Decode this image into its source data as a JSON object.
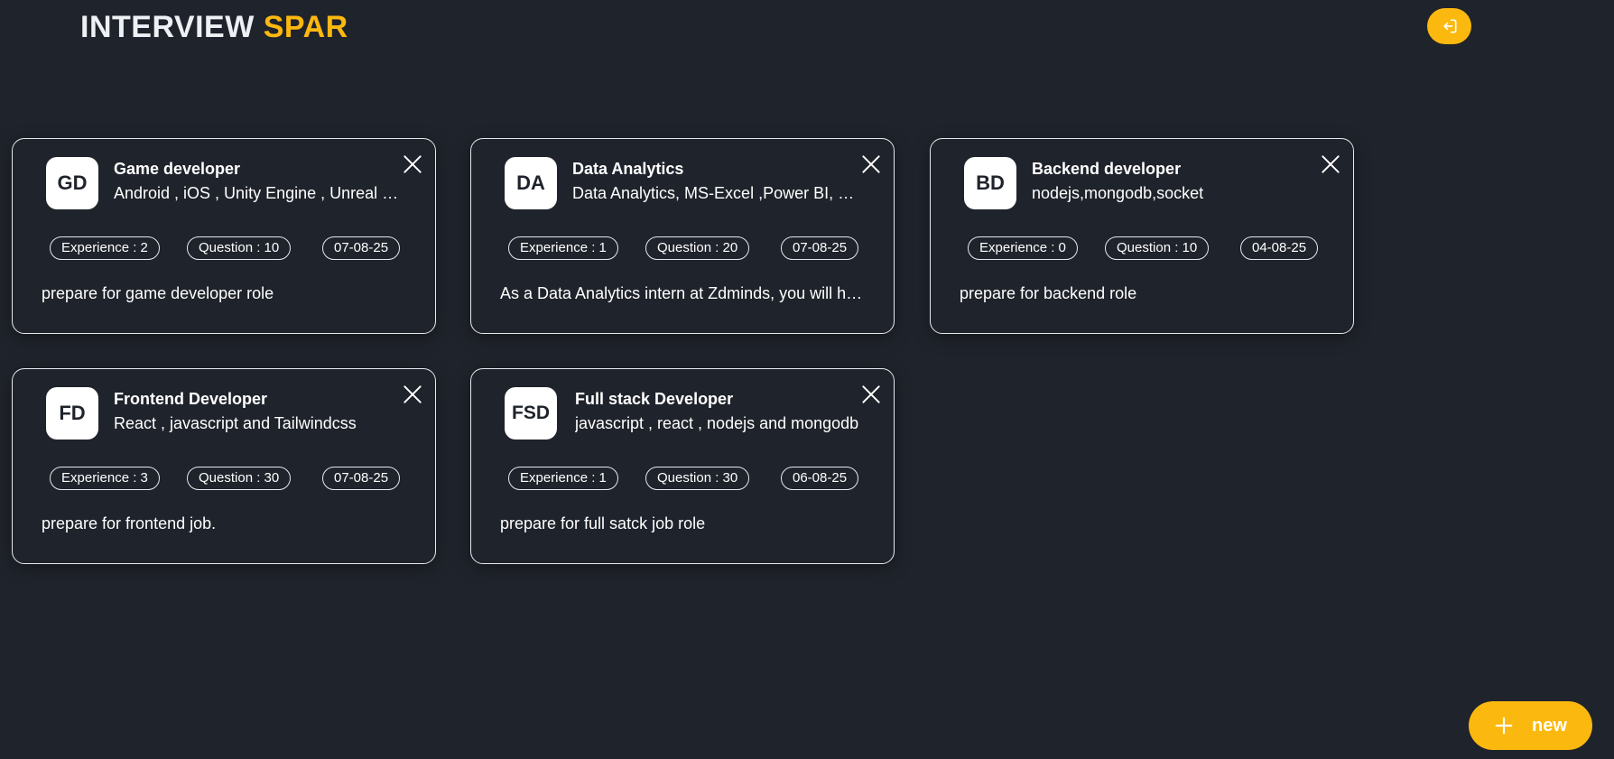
{
  "header": {
    "logo_part1": "INTERVIEW",
    "logo_part2": "SPAR",
    "logout_icon": "logout-icon"
  },
  "colors": {
    "background": "#1f232b",
    "accent": "#fbb80f",
    "card_border": "#e6e8ec",
    "text": "#ffffff"
  },
  "sessions": [
    {
      "initials": "GD",
      "title": "Game developer",
      "skills": "Android , iOS , Unity Engine , Unreal Engine",
      "experience": "Experience : 2",
      "questions": "Question : 10",
      "date": "07-08-25",
      "description": "prepare for game developer role"
    },
    {
      "initials": "DA",
      "title": "Data Analytics",
      "skills": "Data Analytics, MS-Excel ,Power BI, Python",
      "experience": "Experience : 1",
      "questions": "Question : 20",
      "date": "07-08-25",
      "description": "As a Data Analytics intern at Zdminds, you will have"
    },
    {
      "initials": "BD",
      "title": "Backend developer",
      "skills": "nodejs,mongodb,socket",
      "experience": "Experience : 0",
      "questions": "Question : 10",
      "date": "04-08-25",
      "description": "prepare for backend role"
    },
    {
      "initials": "FD",
      "title": "Frontend Developer",
      "skills": "React , javascript and Tailwindcss",
      "experience": "Experience : 3",
      "questions": "Question : 30",
      "date": "07-08-25",
      "description": "prepare for frontend job."
    },
    {
      "initials": "FSD",
      "title": "Full stack Developer",
      "skills": "javascript , react , nodejs and mongodb",
      "experience": "Experience : 1",
      "questions": "Question : 30",
      "date": "06-08-25",
      "description": "prepare for full satck job role"
    }
  ],
  "new_button": {
    "label": "new",
    "icon": "plus-icon"
  }
}
